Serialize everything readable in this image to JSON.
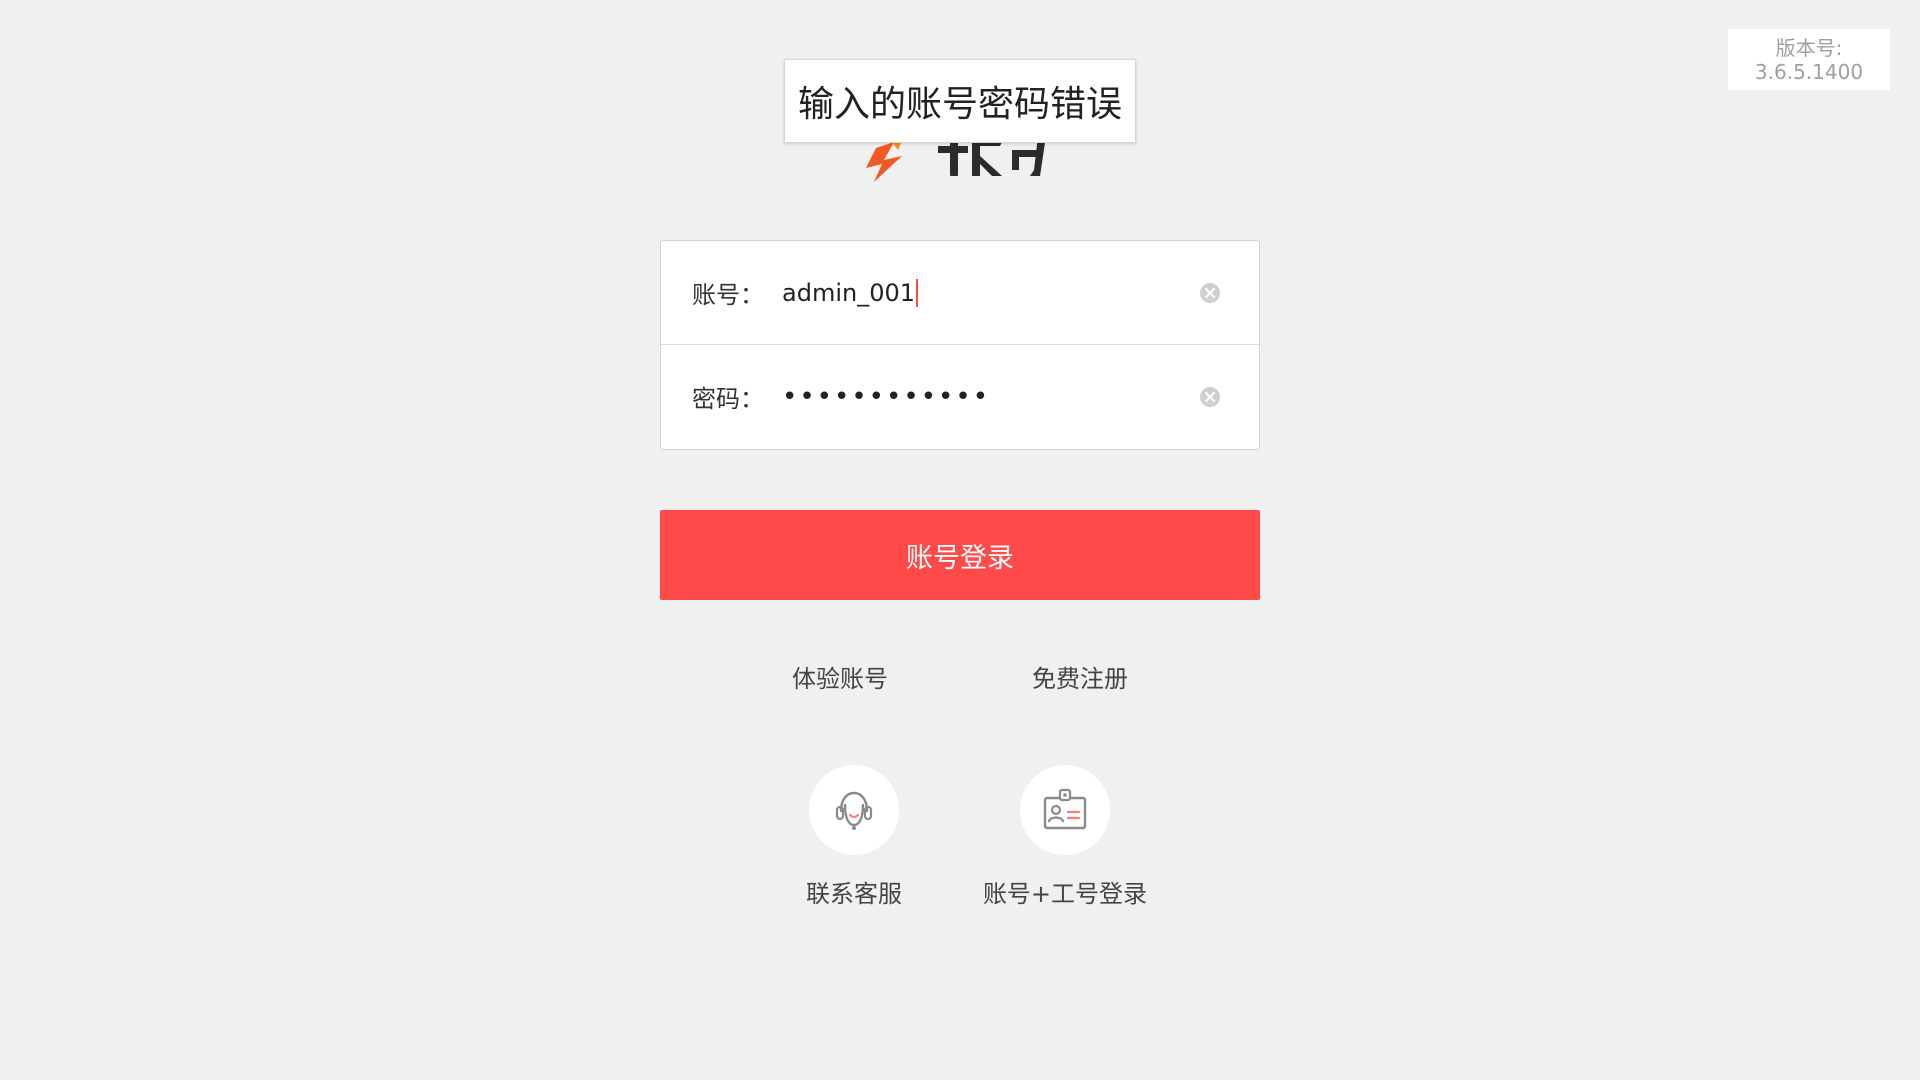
{
  "version": {
    "label": "版本号:",
    "number": "3.6.5.1400"
  },
  "toast": {
    "message": "输入的账号密码错误"
  },
  "brand": {
    "accent_color": "#ff4a4a"
  },
  "form": {
    "account_label": "账号：",
    "account_value": "admin_001",
    "password_label": "密码：",
    "password_value": "••••••••••••"
  },
  "login_button": {
    "label": "账号登录"
  },
  "links": {
    "trial": "体验账号",
    "register": "免费注册"
  },
  "bottom_actions": {
    "customer_service": {
      "label": "联系客服",
      "icon": "headset-icon"
    },
    "staff_login": {
      "label": "账号+工号登录",
      "icon": "id-badge-icon"
    }
  }
}
